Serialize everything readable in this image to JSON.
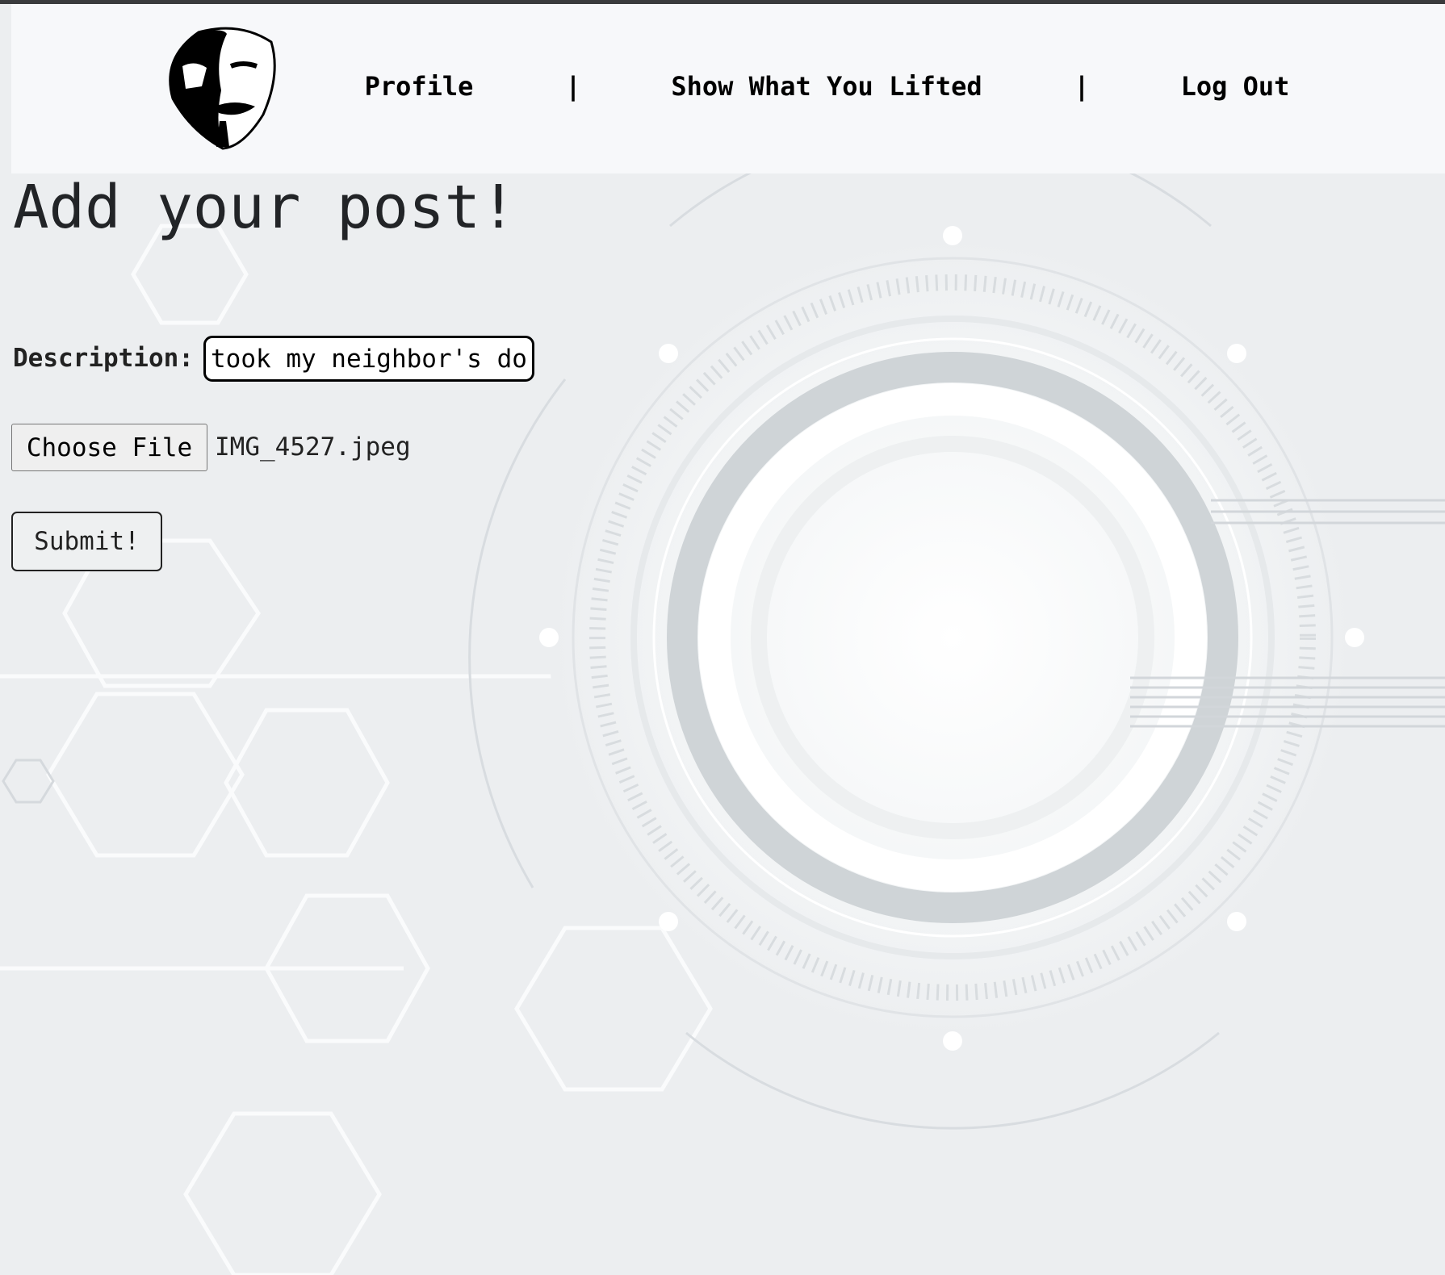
{
  "header": {
    "logo_alt": "Guy Fawkes mask logo",
    "nav": [
      {
        "label": "Profile"
      },
      {
        "label": "Show What You Lifted"
      },
      {
        "label": "Log Out"
      }
    ],
    "separator": "|"
  },
  "main": {
    "title": "Add your post!",
    "description_label": "Description:",
    "description_value": "took my neighbor's dog",
    "choose_file_label": "Choose File",
    "file_name": "IMG_4527.jpeg",
    "submit_label": "Submit!"
  }
}
